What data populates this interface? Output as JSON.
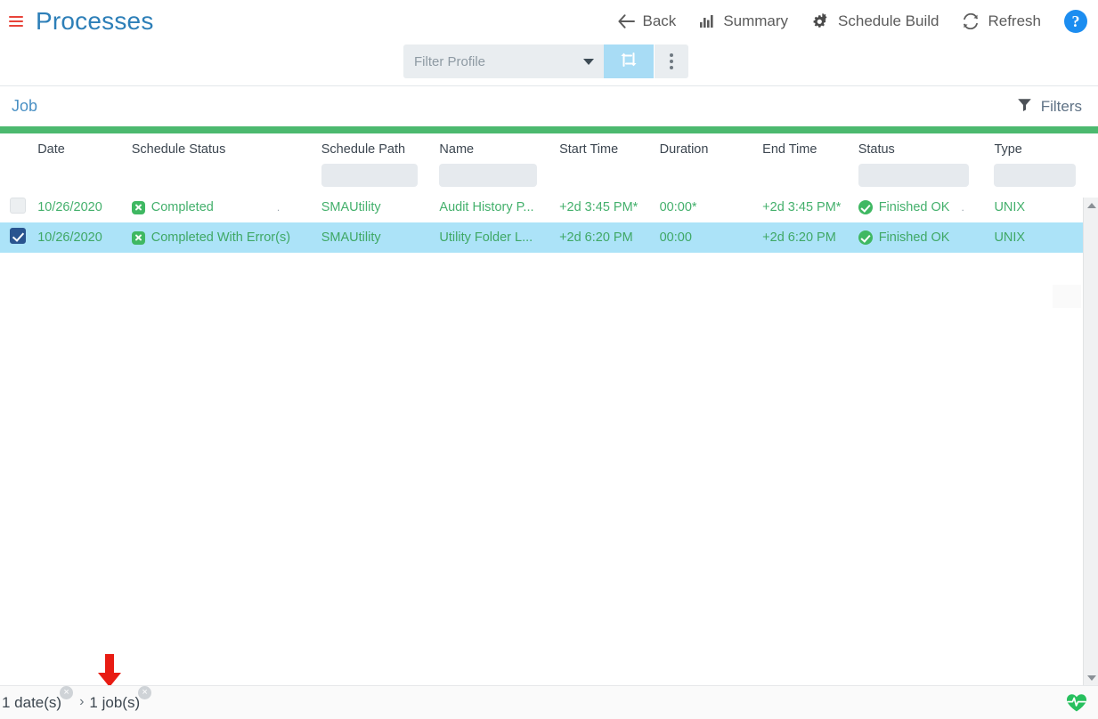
{
  "app": {
    "title": "Processes",
    "menu_icon": "hamburger-icon",
    "help_icon": "question-mark-icon"
  },
  "toolbar": {
    "actions": [
      {
        "label": "Back",
        "icon": "arrow-left-icon"
      },
      {
        "label": "Summary",
        "icon": "bar-chart-icon"
      },
      {
        "label": "Schedule Build",
        "icon": "gears-icon"
      },
      {
        "label": "Refresh",
        "icon": "refresh-icon"
      }
    ],
    "help_label": "?"
  },
  "filter_profile": {
    "placeholder": "Filter Profile",
    "value": "",
    "swap_icon": "exchange-arrows-icon",
    "more_icon": "vertical-dots-icon"
  },
  "subheader": {
    "breadcrumb_label": "Job",
    "filters_label": "Filters",
    "filters_icon": "funnel-icon"
  },
  "table": {
    "columns": [
      {
        "key": "select",
        "label": "",
        "filter": false
      },
      {
        "key": "date",
        "label": "Date",
        "filter": false
      },
      {
        "key": "schedule_status",
        "label": "Schedule Status",
        "filter": false
      },
      {
        "key": "schedule_path",
        "label": "Schedule Path",
        "filter": true
      },
      {
        "key": "name",
        "label": "Name",
        "filter": true
      },
      {
        "key": "start_time",
        "label": "Start Time",
        "filter": false
      },
      {
        "key": "duration",
        "label": "Duration",
        "filter": false
      },
      {
        "key": "end_time",
        "label": "End Time",
        "filter": false
      },
      {
        "key": "status",
        "label": "Status",
        "filter": true
      },
      {
        "key": "type",
        "label": "Type",
        "filter": true
      }
    ],
    "filter_values": {
      "schedule_path": "",
      "name": "",
      "status": "",
      "type": ""
    },
    "rows": [
      {
        "selected": false,
        "date": "10/26/2020",
        "schedule_status": "Completed",
        "schedule_status_icon": "green-x-square-icon",
        "schedule_status_note": ".",
        "schedule_path": "SMAUtility",
        "name": "Audit History P...",
        "start_time": "+2d 3:45 PM*",
        "duration": "00:00*",
        "end_time": "+2d 3:45 PM*",
        "status": "Finished OK",
        "status_icon": "green-check-circle-icon",
        "status_note": ".",
        "type": "UNIX"
      },
      {
        "selected": true,
        "date": "10/26/2020",
        "schedule_status": "Completed With Error(s)",
        "schedule_status_icon": "green-x-square-icon",
        "schedule_status_note": "",
        "schedule_path": "SMAUtility",
        "name": "Utility Folder L...",
        "start_time": "+2d 6:20 PM",
        "duration": "00:00",
        "end_time": "+2d 6:20 PM",
        "status": "Finished OK",
        "status_icon": "green-check-circle-icon",
        "status_note": "",
        "type": "UNIX"
      }
    ]
  },
  "scrollbar": {
    "up_icon": "triangle-up-icon",
    "down_icon": "triangle-down-icon"
  },
  "statusbar": {
    "crumbs": [
      {
        "label": "1 date(s)",
        "close": "×"
      },
      {
        "label": "1 job(s)",
        "close": "×"
      }
    ],
    "separator": "›",
    "health_icon": "heartbeat-icon"
  },
  "annotation": {
    "pointer_icon": "red-down-arrow-icon",
    "pointer_color": "#e81c13"
  },
  "colors": {
    "title_blue": "#2d7fb8",
    "accent_green": "#4cb96f",
    "row_selected": "#ace3f8",
    "swap_button": "#a8dcf5",
    "checkbox_checked": "#29548f",
    "help_blue": "#1c8df0",
    "hamburger_red": "#e8443a"
  }
}
